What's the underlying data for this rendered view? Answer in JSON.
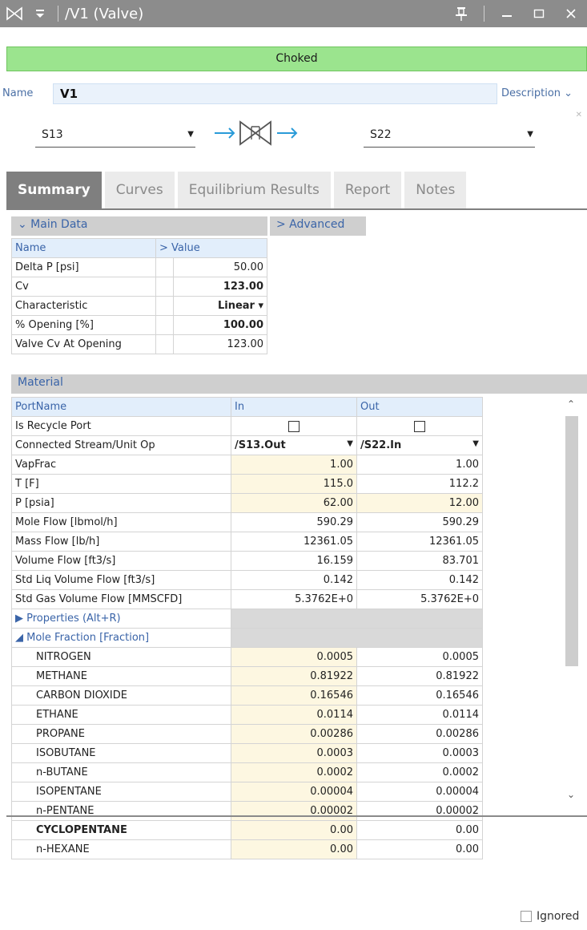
{
  "window": {
    "title": "/V1 (Valve)",
    "pin_icon": "pin-icon",
    "minimize_icon": "minimize-icon",
    "maximize_icon": "maximize-icon",
    "close_icon": "close-icon"
  },
  "status": {
    "text": "Choked",
    "color": "#9be48e"
  },
  "name": {
    "label": "Name",
    "value": "V1",
    "description_label": "Description ⌄"
  },
  "streams": {
    "inlet": "S13",
    "outlet": "S22"
  },
  "tabs": [
    "Summary",
    "Curves",
    "Equilibrium Results",
    "Report",
    "Notes"
  ],
  "main_data": {
    "header": "⌄ Main Data",
    "advanced": "> Advanced",
    "col_name": "Name",
    "col_value": "> Value",
    "rows": [
      {
        "name": "Delta P [psi]",
        "value": "50.00"
      },
      {
        "name": "Cv",
        "value": "123.00"
      },
      {
        "name": "Characteristic",
        "value": "Linear ▾"
      },
      {
        "name": "% Opening [%]",
        "value": "100.00"
      },
      {
        "name": "Valve Cv At Opening",
        "value": "123.00"
      }
    ]
  },
  "material": {
    "header": "Material",
    "col_port": "PortName",
    "col_in": "In",
    "col_out": "Out",
    "recycle_label": "Is Recycle Port",
    "connected_label": "Connected Stream/Unit Op",
    "connected_in": "/S13.Out",
    "connected_out": "/S22.In",
    "rows": [
      {
        "name": "VapFrac",
        "in": "1.00",
        "out": "1.00"
      },
      {
        "name": "T [F]",
        "in": "115.0",
        "out": "112.2"
      },
      {
        "name": "P [psia]",
        "in": "62.00",
        "out": "12.00"
      },
      {
        "name": "Mole Flow [lbmol/h]",
        "in": "590.29",
        "out": "590.29"
      },
      {
        "name": "Mass Flow [lb/h]",
        "in": "12361.05",
        "out": "12361.05"
      },
      {
        "name": "Volume Flow [ft3/s]",
        "in": "16.159",
        "out": "83.701"
      },
      {
        "name": "Std Liq Volume Flow [ft3/s]",
        "in": "0.142",
        "out": "0.142"
      },
      {
        "name": "Std Gas Volume Flow [MMSCFD]",
        "in": "5.3762E+0",
        "out": "5.3762E+0"
      }
    ],
    "properties_label": "▶ Properties (Alt+R)",
    "mole_fraction_label": "◢ Mole Fraction [Fraction]",
    "components": [
      {
        "name": "NITROGEN",
        "in": "0.0005",
        "out": "0.0005"
      },
      {
        "name": "METHANE",
        "in": "0.81922",
        "out": "0.81922"
      },
      {
        "name": "CARBON DIOXIDE",
        "in": "0.16546",
        "out": "0.16546"
      },
      {
        "name": "ETHANE",
        "in": "0.0114",
        "out": "0.0114"
      },
      {
        "name": "PROPANE",
        "in": "0.00286",
        "out": "0.00286"
      },
      {
        "name": "ISOBUTANE",
        "in": "0.0003",
        "out": "0.0003"
      },
      {
        "name": "n-BUTANE",
        "in": "0.0002",
        "out": "0.0002"
      },
      {
        "name": "ISOPENTANE",
        "in": "0.00004",
        "out": "0.00004"
      },
      {
        "name": "n-PENTANE",
        "in": "0.00002",
        "out": "0.00002"
      },
      {
        "name": "CYCLOPENTANE",
        "in": "0.00",
        "out": "0.00"
      },
      {
        "name": "n-HEXANE",
        "in": "0.00",
        "out": "0.00"
      }
    ]
  },
  "ignored_label": "Ignored"
}
